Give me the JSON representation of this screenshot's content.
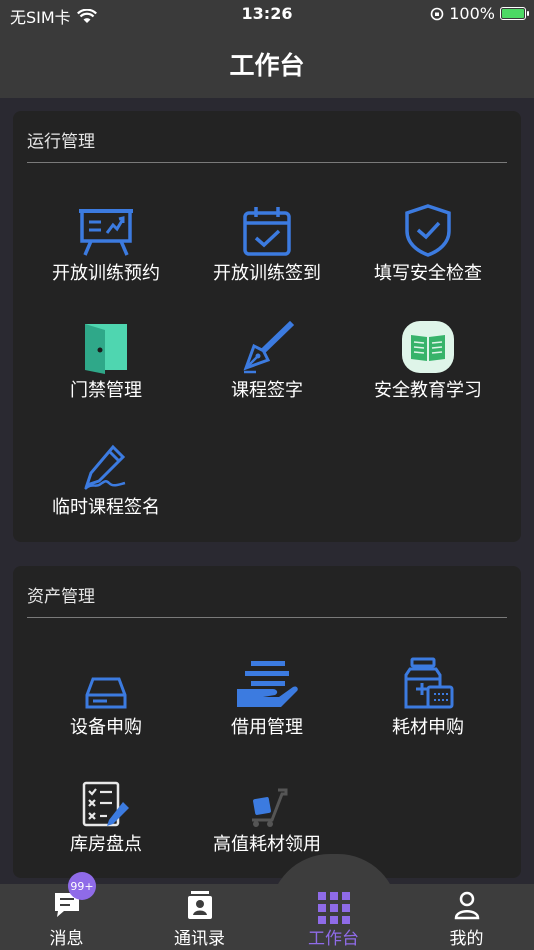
{
  "status": {
    "carrier": "无SIM卡",
    "time": "13:26",
    "battery": "100%",
    "battery_level": 1.0
  },
  "header": {
    "title": "工作台"
  },
  "sections": {
    "ops": {
      "title": "运行管理",
      "items": [
        {
          "label": "开放训练预约",
          "icon": "presentation-board-icon"
        },
        {
          "label": "开放训练签到",
          "icon": "calendar-check-icon"
        },
        {
          "label": "填写安全检查",
          "icon": "shield-check-icon"
        },
        {
          "label": "门禁管理",
          "icon": "door-icon"
        },
        {
          "label": "课程签字",
          "icon": "fountain-pen-icon"
        },
        {
          "label": "安全教育学习",
          "icon": "book-icon"
        },
        {
          "label": "临时课程签名",
          "icon": "signature-pen-icon"
        }
      ]
    },
    "assets": {
      "title": "资产管理",
      "items": [
        {
          "label": "设备申购",
          "icon": "hard-drive-icon"
        },
        {
          "label": "借用管理",
          "icon": "hand-document-icon"
        },
        {
          "label": "耗材申购",
          "icon": "medicine-bottle-icon"
        },
        {
          "label": "库房盘点",
          "icon": "checklist-icon"
        },
        {
          "label": "高值耗材领用",
          "icon": "cart-icon"
        }
      ]
    }
  },
  "tabbar": {
    "badge": "99+",
    "tabs": [
      {
        "label": "消息",
        "icon": "message-icon"
      },
      {
        "label": "通讯录",
        "icon": "contacts-icon"
      },
      {
        "label": "工作台",
        "icon": "grid-icon",
        "active": true
      },
      {
        "label": "我的",
        "icon": "user-icon"
      }
    ]
  },
  "colors": {
    "accent": "#8f6be8",
    "icon_blue": "#3c7be0",
    "icon_teal": "#4fd6b0",
    "card": "#232323"
  }
}
